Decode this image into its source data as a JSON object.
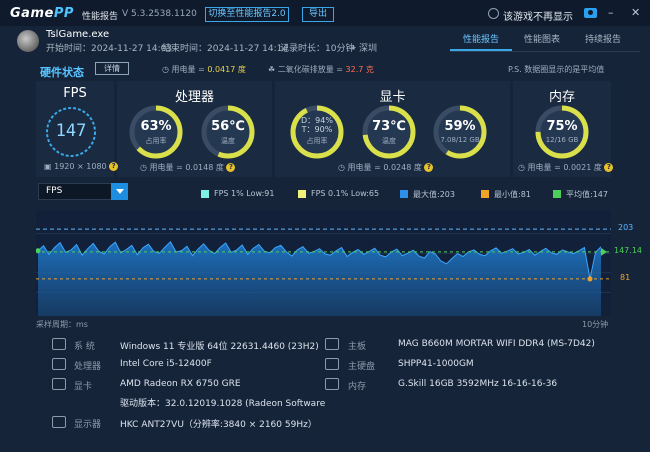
{
  "header": {
    "logo_a": "Game",
    "logo_b": "PP",
    "label": "性能报告",
    "version": "V 5.3.2538.1120",
    "switch_btn": "切换至性能报告2.0",
    "export_btn": "导出",
    "hide_label": "该游戏不再显示",
    "minimize": "–",
    "close": "✕"
  },
  "game": {
    "name": "TslGame.exe",
    "start": "开始时间：2024-11-27 14:03",
    "end": "结束时间：2024-11-27 14:14",
    "duration": "记录时长：10分钟",
    "location": "深圳"
  },
  "tabs": [
    "性能报告",
    "性能图表",
    "持续报告"
  ],
  "hardware": {
    "title": "硬件状态",
    "detail_btn": "详情",
    "power_label": "用电量 = ",
    "power_value": "0.0417 度",
    "co2_label": "二氧化碳排放量 = ",
    "co2_value": "32.7 克",
    "note": "P.S. 数据圈显示的是平均值"
  },
  "fps_card": {
    "title": "FPS",
    "value": "147",
    "resolution": "1920 × 1080"
  },
  "cpu_card": {
    "title": "处理器",
    "usage_value": "63%",
    "usage_label": "占用率",
    "temp_value": "56℃",
    "temp_label": "温度",
    "power": "用电量 = 0.0148 度"
  },
  "gpu_card": {
    "title": "显卡",
    "d_line": "D：94%",
    "t_line": "T：90%",
    "usage_label": "占用率",
    "temp_value": "73℃",
    "temp_label": "温度",
    "vram_value": "59%",
    "vram_sub": "7.08/12 GB",
    "power": "用电量 = 0.0248 度"
  },
  "mem_card": {
    "title": "内存",
    "value": "75%",
    "sub": "12/16 GB",
    "power": "用电量 = 0.0021 度"
  },
  "chart_controls": {
    "selected": "FPS",
    "legend": [
      {
        "label": "FPS 1% Low:91",
        "color": "#7ef0e6"
      },
      {
        "label": "FPS 0.1% Low:65",
        "color": "#f2ee7a"
      },
      {
        "label": "最大值:203",
        "color": "#2f8fe8"
      },
      {
        "label": "最小值:81",
        "color": "#f0a326"
      },
      {
        "label": "平均值:147",
        "color": "#4cd05a"
      }
    ]
  },
  "chart_data": {
    "type": "area",
    "series_name": "FPS",
    "y_max": 203,
    "y_min_marker": 81,
    "y_avg": 147.14,
    "ylim": [
      0,
      240
    ],
    "max_label": "203",
    "avg_label": "147.14",
    "min_label": "81",
    "values": [
      150,
      162,
      141,
      158,
      170,
      146,
      152,
      165,
      139,
      155,
      168,
      149,
      142,
      160,
      171,
      145,
      153,
      163,
      140,
      157,
      166,
      148,
      144,
      159,
      172,
      147,
      150,
      161,
      138,
      154,
      167,
      151,
      143,
      158,
      169,
      146,
      152,
      164,
      141,
      156,
      165,
      149,
      145,
      158,
      163,
      147,
      137,
      152,
      160,
      144,
      148,
      155,
      142,
      139,
      150,
      158,
      136,
      146,
      153,
      141,
      148,
      156,
      139,
      135,
      147,
      154,
      138,
      144,
      151,
      137,
      132,
      148,
      142,
      125,
      118,
      131,
      143,
      136,
      147,
      152,
      141,
      138,
      150,
      157,
      144,
      149,
      155,
      142,
      146,
      153,
      139,
      148,
      156,
      145,
      141,
      152,
      147,
      143,
      150,
      158,
      81,
      146,
      160
    ]
  },
  "chart_footer": {
    "left": "采样周期：ms",
    "right": "10分钟"
  },
  "sysinfo": {
    "os_label": "系  统",
    "os_value": "Windows 11 专业版 64位 22631.4460 (23H2)",
    "board_label": "主板",
    "board_value": "MAG B660M MORTAR WIFI DDR4 (MS-7D42)",
    "cpu_label": "处理器",
    "cpu_value": "Intel Core i5-12400F",
    "disk_label": "主硬盘",
    "disk_value": "SHPP41-1000GM",
    "gpu_label": "显卡",
    "gpu_value": "AMD Radeon RX 6750 GRE",
    "mem_label": "内存",
    "mem_value": "G.Skill 16GB 3592MHz 16-16-16-36",
    "driver_value": "驱动版本：32.0.12019.1028 (Radeon Software Adrenalin)",
    "monitor_label": "显示器",
    "monitor_value": "HKC ANT27VU（分辨率:3840 × 2160 59Hz）"
  }
}
